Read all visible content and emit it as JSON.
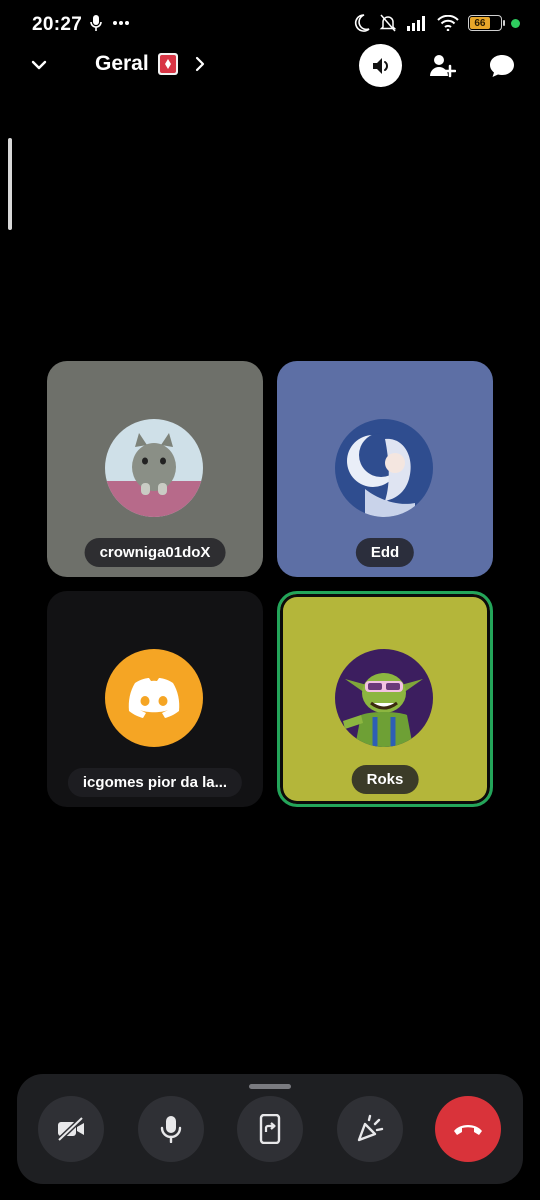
{
  "status_bar": {
    "time": "20:27",
    "battery_level": "66",
    "icons": [
      "mic-icon",
      "more-dots-icon",
      "moon-icon",
      "bell-off-icon",
      "signal-icon",
      "wifi-icon",
      "battery-icon",
      "active-dot"
    ]
  },
  "header": {
    "title": "Geral",
    "icons": [
      "chevron-down-icon",
      "channel-emoji-icon",
      "chevron-right-icon",
      "speaker-icon",
      "add-user-icon",
      "chat-bubble-icon"
    ]
  },
  "participants": [
    {
      "name": "crowniga01doX",
      "tile_color": "#6e706a",
      "avatar": "cat-photo"
    },
    {
      "name": "Edd",
      "tile_color": "#5d6fa5",
      "avatar": "anime-character"
    },
    {
      "name": "icgomes pior da la...",
      "tile_color": "#121214",
      "avatar": "discord-logo",
      "avatar_color": "#f5a524"
    },
    {
      "name": "Roks",
      "tile_color": "#b4b63a",
      "avatar": "goblin-character",
      "speaking": true,
      "speaking_color": "#23a55a"
    }
  ],
  "controls": [
    {
      "name": "camera-off",
      "icon": "video-off-icon"
    },
    {
      "name": "microphone",
      "icon": "mic-icon"
    },
    {
      "name": "screen-share",
      "icon": "screen-share-icon"
    },
    {
      "name": "activities",
      "icon": "activities-icon"
    },
    {
      "name": "disconnect",
      "icon": "hangup-icon",
      "color": "#d9333a"
    }
  ]
}
